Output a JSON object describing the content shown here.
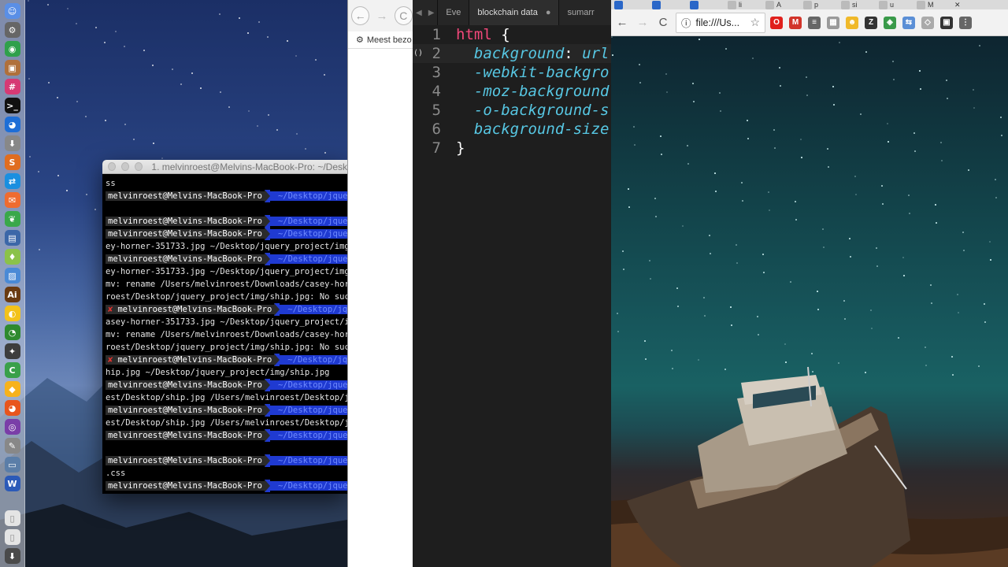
{
  "dock": {
    "icons": [
      {
        "name": "finder-icon",
        "color": "#5a8fe6",
        "glyph": "☺"
      },
      {
        "name": "system-prefs-icon",
        "color": "#666",
        "glyph": "⚙"
      },
      {
        "name": "chrome-icon",
        "color": "#2fa04b",
        "glyph": "◉"
      },
      {
        "name": "preview-icon",
        "color": "#b0703b",
        "glyph": "▣"
      },
      {
        "name": "slack-icon",
        "color": "#d63a74",
        "glyph": "#"
      },
      {
        "name": "terminal-icon",
        "color": "#111",
        "glyph": ">_"
      },
      {
        "name": "firefox-blue-icon",
        "color": "#1e6ed6",
        "glyph": "◕"
      },
      {
        "name": "installer-icon",
        "color": "#888",
        "glyph": "⬇"
      },
      {
        "name": "sublime-icon",
        "color": "#e06d1f",
        "glyph": "S"
      },
      {
        "name": "teamviewer-icon",
        "color": "#1a8fe0",
        "glyph": "⇄"
      },
      {
        "name": "postman-icon",
        "color": "#ef6c30",
        "glyph": "✉"
      },
      {
        "name": "evernote-icon",
        "color": "#3aa84a",
        "glyph": "❦"
      },
      {
        "name": "virtualbox-icon",
        "color": "#3c67a8",
        "glyph": "▤"
      },
      {
        "name": "android-icon",
        "color": "#8bc24a",
        "glyph": "♦"
      },
      {
        "name": "photos-icon",
        "color": "#4a8ad6",
        "glyph": "▨"
      },
      {
        "name": "illustrator-icon",
        "color": "#6a3b12",
        "glyph": "Ai"
      },
      {
        "name": "cyberduck-icon",
        "color": "#f3c21a",
        "glyph": "◐"
      },
      {
        "name": "pacman-icon",
        "color": "#2e8a2e",
        "glyph": "◔"
      },
      {
        "name": "safari-icon",
        "color": "#3d3d3d",
        "glyph": "✦"
      },
      {
        "name": "camtasia-icon",
        "color": "#3aa04a",
        "glyph": "C"
      },
      {
        "name": "sketch-icon",
        "color": "#f7b21b",
        "glyph": "◆"
      },
      {
        "name": "firefox-icon",
        "color": "#e8551d",
        "glyph": "◕"
      },
      {
        "name": "tor-icon",
        "color": "#7a3ea8",
        "glyph": "◎"
      },
      {
        "name": "script-editor-icon",
        "color": "#888",
        "glyph": "✎"
      },
      {
        "name": "scanner-icon",
        "color": "#5b7ea8",
        "glyph": "▭"
      },
      {
        "name": "word-icon",
        "color": "#2b5ab8",
        "glyph": "W"
      },
      {
        "name": "document-icon",
        "color": "#e4e4e4",
        "glyph": "▯"
      },
      {
        "name": "document2-icon",
        "color": "#e4e4e4",
        "glyph": "▯"
      },
      {
        "name": "download-icon",
        "color": "#4a4a4a",
        "glyph": "⬇"
      }
    ]
  },
  "terminal": {
    "title": "1. melvinroest@Melvins-MacBook-Pro: ~/Desk",
    "user": "melvinroest@Melvins-MacBook-Pro",
    "path": "~/Desktop/jque",
    "lines": [
      {
        "type": "text",
        "text": "ss"
      },
      {
        "type": "prompt",
        "user": "melvinroest@Melvins-MacBook-Pro",
        "path": "~/Desktop/jque"
      },
      {
        "type": "text",
        "text": ""
      },
      {
        "type": "prompt",
        "user": "melvinroest@Melvins-MacBook-Pro",
        "path": "~/Desktop/jque"
      },
      {
        "type": "prompt",
        "user": "melvinroest@Melvins-MacBook-Pro",
        "path": "~/Desktop/jque"
      },
      {
        "type": "text",
        "text": "ey-horner-351733.jpg ~/Desktop/jquery_project/img"
      },
      {
        "type": "prompt",
        "user": "melvinroest@Melvins-MacBook-Pro",
        "path": "~/Desktop/jque"
      },
      {
        "type": "text",
        "text": "ey-horner-351733.jpg ~/Desktop/jquery_project/img"
      },
      {
        "type": "text",
        "text": "mv: rename /Users/melvinroest/Downloads/casey-hor"
      },
      {
        "type": "text",
        "text": "roest/Desktop/jquery_project/img/ship.jpg: No such"
      },
      {
        "type": "prompt-x",
        "user": "melvinroest@Melvins-MacBook-Pro",
        "path": "~/Desktop/jq"
      },
      {
        "type": "text",
        "text": "asey-horner-351733.jpg ~/Desktop/jquery_project/im"
      },
      {
        "type": "text",
        "text": "mv: rename /Users/melvinroest/Downloads/casey-hor"
      },
      {
        "type": "text",
        "text": "roest/Desktop/jquery_project/img/ship.jpg: No such"
      },
      {
        "type": "prompt-x",
        "user": "melvinroest@Melvins-MacBook-Pro",
        "path": "~/Desktop/jq"
      },
      {
        "type": "text",
        "text": "hip.jpg ~/Desktop/jquery_project/img/ship.jpg"
      },
      {
        "type": "prompt",
        "user": "melvinroest@Melvins-MacBook-Pro",
        "path": "~/Desktop/jque"
      },
      {
        "type": "text",
        "text": "est/Desktop/ship.jpg /Users/melvinroest/Desktop/jq"
      },
      {
        "type": "prompt",
        "user": "melvinroest@Melvins-MacBook-Pro",
        "path": "~/Desktop/jque"
      },
      {
        "type": "text",
        "text": "est/Desktop/ship.jpg /Users/melvinroest/Desktop/jq"
      },
      {
        "type": "prompt",
        "user": "melvinroest@Melvins-MacBook-Pro",
        "path": "~/Desktop/jque"
      },
      {
        "type": "text",
        "text": ""
      },
      {
        "type": "prompt",
        "user": "melvinroest@Melvins-MacBook-Pro",
        "path": "~/Desktop/jque"
      },
      {
        "type": "text",
        "text": ".css"
      },
      {
        "type": "prompt",
        "user": "melvinroest@Melvins-MacBook-Pro",
        "path": "~/Desktop/jque"
      }
    ]
  },
  "mid_browser": {
    "back": "←",
    "forward": "→",
    "reload": "C",
    "bookmark_label": "Meest bezo"
  },
  "editor": {
    "tabs": [
      "Eve",
      "blockchain data",
      "sumarr"
    ],
    "nav_back": "◀",
    "nav_fwd": "▶",
    "modified_dot": "●",
    "gutter_marker": "()",
    "lines": [
      {
        "n": "1",
        "parts": [
          {
            "c": "sel",
            "t": "html"
          },
          {
            "c": "brace",
            "t": " {"
          }
        ]
      },
      {
        "n": "2",
        "parts": [
          {
            "c": "prop",
            "t": "  background"
          },
          {
            "c": "brace",
            "t": ": "
          },
          {
            "c": "prop",
            "t": "url"
          }
        ]
      },
      {
        "n": "3",
        "parts": [
          {
            "c": "prop",
            "t": "  -webkit-backgro"
          }
        ]
      },
      {
        "n": "4",
        "parts": [
          {
            "c": "prop",
            "t": "  -moz-background"
          }
        ]
      },
      {
        "n": "5",
        "parts": [
          {
            "c": "prop",
            "t": "  -o-background-s"
          }
        ]
      },
      {
        "n": "6",
        "parts": [
          {
            "c": "prop",
            "t": "  background-size"
          }
        ]
      },
      {
        "n": "7",
        "parts": [
          {
            "c": "brace",
            "t": "}"
          }
        ]
      }
    ]
  },
  "chrome": {
    "tabs": [
      "",
      "",
      "",
      "li",
      "A",
      "p",
      "si",
      "u",
      "M",
      "✕"
    ],
    "back": "←",
    "forward": "→",
    "reload": "C",
    "url": "file:///Us...",
    "info_icon": "ⓘ",
    "bookmark_star": "☆",
    "extensions": [
      {
        "name": "opera-ext-icon",
        "color": "#e0201c",
        "glyph": "O"
      },
      {
        "name": "m-ext-icon",
        "color": "#d2342a",
        "glyph": "M"
      },
      {
        "name": "notes-ext-icon",
        "color": "#666",
        "glyph": "≡"
      },
      {
        "name": "grid-ext-icon",
        "color": "#9a9a9a",
        "glyph": "▦"
      },
      {
        "name": "emoji-ext-icon",
        "color": "#f0b92a",
        "glyph": "☻"
      },
      {
        "name": "z-ext-icon",
        "color": "#333",
        "glyph": "Z"
      },
      {
        "name": "color-ext-icon",
        "color": "#3a9a4a",
        "glyph": "◈"
      },
      {
        "name": "translate-ext-icon",
        "color": "#5b8fd6",
        "glyph": "⇆"
      },
      {
        "name": "layers-ext-icon",
        "color": "#aaa",
        "glyph": "◇"
      },
      {
        "name": "tab-ext-icon",
        "color": "#333",
        "glyph": "▣"
      },
      {
        "name": "menu-ext-icon",
        "color": "#666",
        "glyph": "⋮"
      }
    ]
  }
}
